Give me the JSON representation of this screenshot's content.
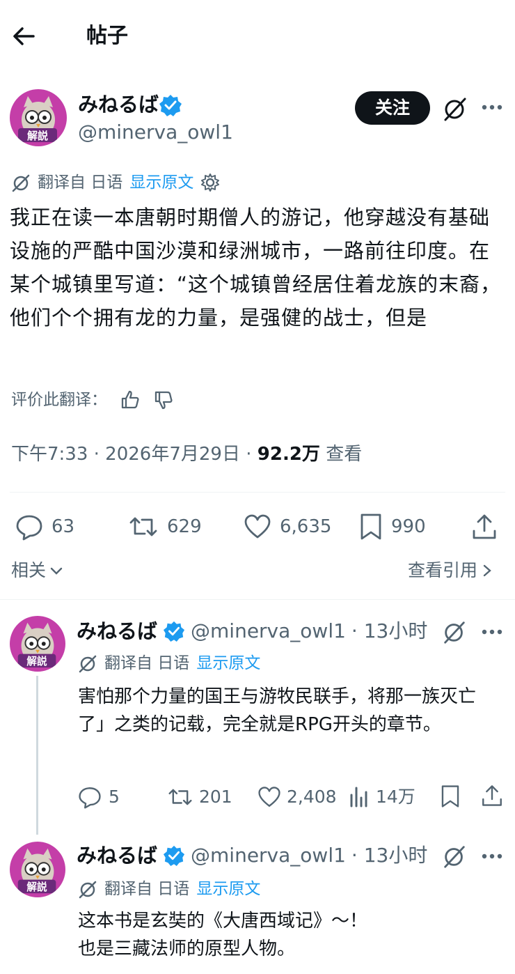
{
  "header": {
    "title": "帖子"
  },
  "post": {
    "author_name": "みねるば",
    "author_handle": "@minerva_owl1",
    "avatar_badge": "解説",
    "follow_label": "关注",
    "translate_label": "翻译自 日语",
    "show_original": "显示原文",
    "text": "我正在读一本唐朝时期僧人的游记，他穿越没有基础设施的严酷中国沙漠和绿洲城市，一路前往印度。在某个城镇里写道：“这个城镇曾经居住着龙族的末裔，他们个个拥有龙的力量，是强健的战士，但是",
    "rate_label": "评价此翻译：",
    "time": "下午7:33 · 2026年7月29日 · ",
    "views": "92.2万",
    "views_label": " 查看",
    "replies": "63",
    "retweets": "629",
    "likes": "6,635",
    "bookmarks": "990",
    "related_label": "相关",
    "quotes_label": "查看引用"
  },
  "replies": [
    {
      "author_name": "みねるば",
      "author_handle": "@minerva_owl1",
      "time": "· 13小时",
      "translate_label": "翻译自 日语",
      "show_original": "显示原文",
      "text": "害怕那个力量的国王与游牧民联手，将那一族灭亡了」之类的记载，完全就是RPG开头的章节。",
      "replies": "5",
      "retweets": "201",
      "likes": "2,408",
      "views": "14万"
    },
    {
      "author_name": "みねるば",
      "author_handle": "@minerva_owl1",
      "time": "· 13小时",
      "translate_label": "翻译自 日语",
      "show_original": "显示原文",
      "text_line1": "这本书是玄奘的《大唐西域记》～！",
      "text_line2": "也是三藏法师的原型人物。"
    }
  ],
  "colors": {
    "accent": "#1d9bf0",
    "text": "#0f1419",
    "muted": "#536471",
    "avatar_bg": "#c43ea8"
  }
}
